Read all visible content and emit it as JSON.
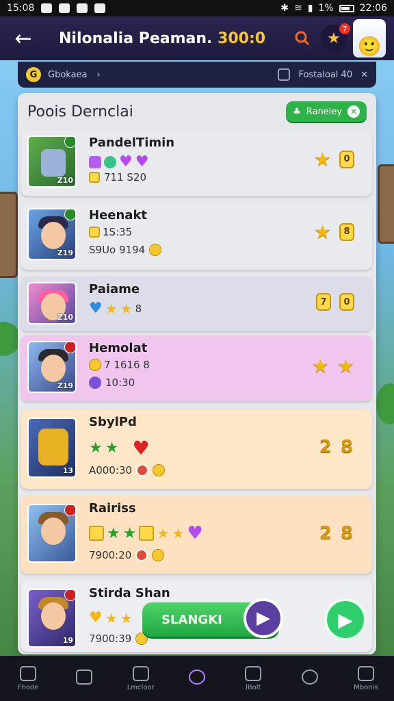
{
  "status_bar": {
    "time_left": "15:08",
    "time_right": "22:06",
    "battery": "1%"
  },
  "app_header": {
    "title": "Nilonalia Peaman.",
    "coins": "300:0",
    "notif_count": "7"
  },
  "filter_bar": {
    "left_label": "Gbokaea",
    "right_label": "Fostaloal 40"
  },
  "panel": {
    "title": "Poois Dernclai",
    "button_label": "Raneley",
    "rows": [
      {
        "name": "PandelTimin",
        "line2": "711 S20",
        "level": "Z10",
        "bg": "#e9eaee"
      },
      {
        "name": "Heenakt",
        "line1": "1S:35",
        "line2": "S9Uo 9194",
        "level": "Z19",
        "bg": "#e9eaee"
      },
      {
        "name": "Paiame",
        "line1": "8",
        "level": "Z10",
        "bg": "#dcdde8"
      },
      {
        "name": "Hemolat",
        "line1": "7 1616 8",
        "line2": "10:30",
        "level": "Z19",
        "bg": "#f0c6ee"
      },
      {
        "name": "SbylPd",
        "line2": "A000:30",
        "level": "13",
        "score": "2 8",
        "bg": "#fde7c8"
      },
      {
        "name": "Rairiss",
        "line2": "7900:20",
        "score": "2 8",
        "bg": "#fde1c0"
      },
      {
        "name": "Stirda Shan",
        "line2": "7900:39",
        "level": "19",
        "bg": "#eceef2"
      }
    ],
    "badges": {
      "row0": "0",
      "row1": "8",
      "row2_left": "7",
      "row2_right": "0"
    }
  },
  "cta": {
    "label": "SLANGKI"
  },
  "bottom_nav": [
    {
      "label": "Fhode"
    },
    {
      "label": ""
    },
    {
      "label": "Lmcloor"
    },
    {
      "label": ""
    },
    {
      "label": "lBolt"
    },
    {
      "label": ""
    },
    {
      "label": "Mbonis"
    }
  ],
  "colors": {
    "accent_gold": "#f9c531",
    "green": "#2eb34a",
    "header": "#2b2550"
  }
}
